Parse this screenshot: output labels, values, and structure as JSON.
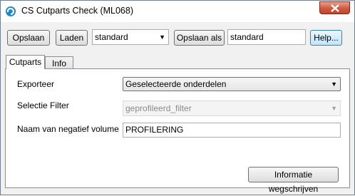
{
  "window": {
    "title": "CS Cutparts Check (ML068)"
  },
  "toolbar": {
    "save_label": "Opslaan",
    "load_label": "Laden",
    "preset_value": "standard",
    "save_as_label": "Opslaan als",
    "save_as_name": "standard",
    "help_label": "Help..."
  },
  "tabs": [
    {
      "label": "Cutparts",
      "active": true
    },
    {
      "label": "Info",
      "active": false
    }
  ],
  "form": {
    "export_label": "Exporteer",
    "export_value": "Geselecteerde onderdelen",
    "filter_label": "Selectie Filter",
    "filter_value": "geprofileerd_filter",
    "volume_label": "Naam van negatief volume",
    "volume_value": "PROFILERING",
    "clear_button_label": "Informatie wegschrijven"
  },
  "colors": {
    "accent": "#3c7fb1",
    "close": "#c0442b"
  }
}
